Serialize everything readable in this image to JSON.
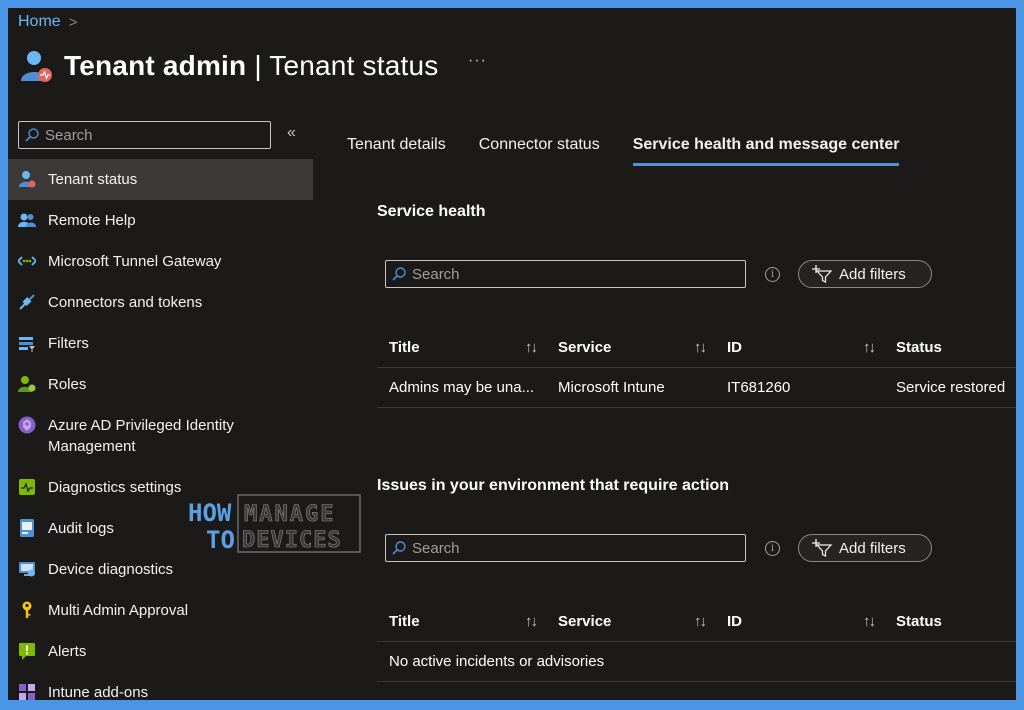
{
  "breadcrumb": {
    "home": "Home",
    "chevron": ">"
  },
  "header": {
    "title_bold": "Tenant admin",
    "separator": " | ",
    "title_rest": "Tenant status",
    "more": "···"
  },
  "sidebar": {
    "search_placeholder": "Search",
    "collapse": "«",
    "items": [
      {
        "label": "Tenant status",
        "icon": "tenant-status-icon"
      },
      {
        "label": "Remote Help",
        "icon": "remote-help-icon"
      },
      {
        "label": "Microsoft Tunnel Gateway",
        "icon": "tunnel-gateway-icon"
      },
      {
        "label": "Connectors and tokens",
        "icon": "connector-icon"
      },
      {
        "label": "Filters",
        "icon": "filter-icon"
      },
      {
        "label": "Roles",
        "icon": "roles-icon"
      },
      {
        "label": "Azure AD Privileged Identity Management",
        "icon": "pim-icon"
      },
      {
        "label": "Diagnostics settings",
        "icon": "diagnostics-icon"
      },
      {
        "label": "Audit logs",
        "icon": "audit-logs-icon"
      },
      {
        "label": "Device diagnostics",
        "icon": "device-diagnostics-icon"
      },
      {
        "label": "Multi Admin Approval",
        "icon": "key-icon"
      },
      {
        "label": "Alerts",
        "icon": "alert-icon"
      },
      {
        "label": "Intune add-ons",
        "icon": "addons-icon"
      }
    ]
  },
  "watermark": {
    "how": "HOW",
    "to": "TO",
    "manage": "MANAGE",
    "devices": "DEVICES"
  },
  "tabs": [
    {
      "label": "Tenant details"
    },
    {
      "label": "Connector status"
    },
    {
      "label": "Service health and message center"
    }
  ],
  "service_health": {
    "title": "Service health",
    "search_placeholder": "Search",
    "info": "i",
    "add_filters": "Add filters",
    "columns": [
      "Title",
      "Service",
      "ID",
      "Status"
    ],
    "sort_icon": "↑↓",
    "rows": [
      {
        "title": "Admins may be una...",
        "service": "Microsoft Intune",
        "id": "IT681260",
        "status": "Service restored"
      }
    ]
  },
  "issues": {
    "title": "Issues in your environment that require action",
    "search_placeholder": "Search",
    "info": "i",
    "add_filters": "Add filters",
    "columns": [
      "Title",
      "Service",
      "ID",
      "Status"
    ],
    "sort_icon": "↑↓",
    "empty_message": "No active incidents or advisories"
  },
  "colors": {
    "accent": "#4f8fd6",
    "background": "#1b1a19",
    "border": "#4b95e6"
  }
}
